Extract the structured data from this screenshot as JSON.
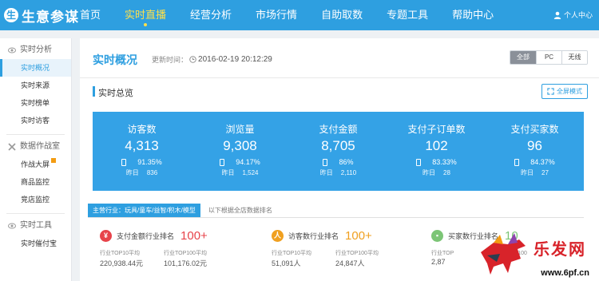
{
  "app": {
    "logo_glyph": "生",
    "logo": "生意参谋"
  },
  "nav": {
    "items": [
      {
        "label": "首页"
      },
      {
        "label": "实时直播"
      },
      {
        "label": "经营分析"
      },
      {
        "label": "市场行情"
      },
      {
        "label": "自助取数"
      },
      {
        "label": "专题工具"
      },
      {
        "label": "帮助中心"
      }
    ],
    "active": "实时直播",
    "user": "个人中心"
  },
  "sidebar": {
    "groups": [
      {
        "title": "实时分析",
        "items": [
          "实时概况",
          "实时来源",
          "实时榜单",
          "实时访客"
        ]
      },
      {
        "title": "数据作战室",
        "items": [
          "作战大屏",
          "商品监控",
          "竞店监控"
        ]
      },
      {
        "title": "实时工具",
        "items": [
          "实时催付宝"
        ]
      }
    ],
    "active_item": "实时概况"
  },
  "page": {
    "title": "实时概况",
    "update_label": "更新时间：",
    "update_time": "2016-02-19 20:12:29",
    "segments": [
      "全部",
      "PC",
      "无线"
    ],
    "active_segment": "全部"
  },
  "summary": {
    "title": "实时总览",
    "fullscreen": "全屏模式",
    "stats": [
      {
        "label": "访客数",
        "value": "4,313",
        "rate": "91.35%",
        "yday_label": "昨日",
        "yday": "836"
      },
      {
        "label": "浏览量",
        "value": "9,308",
        "rate": "94.17%",
        "yday_label": "昨日",
        "yday": "1,524"
      },
      {
        "label": "支付金额",
        "value": "8,705",
        "rate": "86%",
        "yday_label": "昨日",
        "yday": "2,110"
      },
      {
        "label": "支付子订单数",
        "value": "102",
        "rate": "83.33%",
        "yday_label": "昨日",
        "yday": "28"
      },
      {
        "label": "支付买家数",
        "value": "96",
        "rate": "84.37%",
        "yday_label": "昨日",
        "yday": "27"
      }
    ]
  },
  "industry": {
    "chip": "主营行业：玩具/童车/益智/积木/模型",
    "note": "以下根据全店数据排名",
    "cards": [
      {
        "name": "支付金额行业排名",
        "rank": "100+",
        "icon": "¥",
        "icon_color": "#e7434a",
        "rank_color": "#e7434a",
        "col1_label": "行业TOP10平均",
        "col1_val": "220,938.44元",
        "col2_label": "行业TOP100平均",
        "col2_val": "101,176.02元"
      },
      {
        "name": "访客数行业排名",
        "rank": "100+",
        "icon": "人",
        "icon_color": "#f0a020",
        "rank_color": "#f0a020",
        "col1_label": "行业TOP10平均",
        "col1_val": "51,091人",
        "col2_label": "行业TOP100平均",
        "col2_val": "24,847人"
      },
      {
        "name": "买家数行业排名",
        "rank": "10",
        "icon": "▪",
        "icon_color": "#7cc576",
        "rank_color": "#7cc576",
        "col1_label": "行业TOP",
        "col1_val": "2,87",
        "col2_label": "行业TOP100",
        "col2_val": ""
      }
    ]
  },
  "watermark": {
    "text": "乐发网",
    "url": "www.6pf.cn"
  },
  "colors": {
    "primary": "#2e9fe0",
    "band": "#34a2e6",
    "active_nav": "#ffe04a"
  }
}
